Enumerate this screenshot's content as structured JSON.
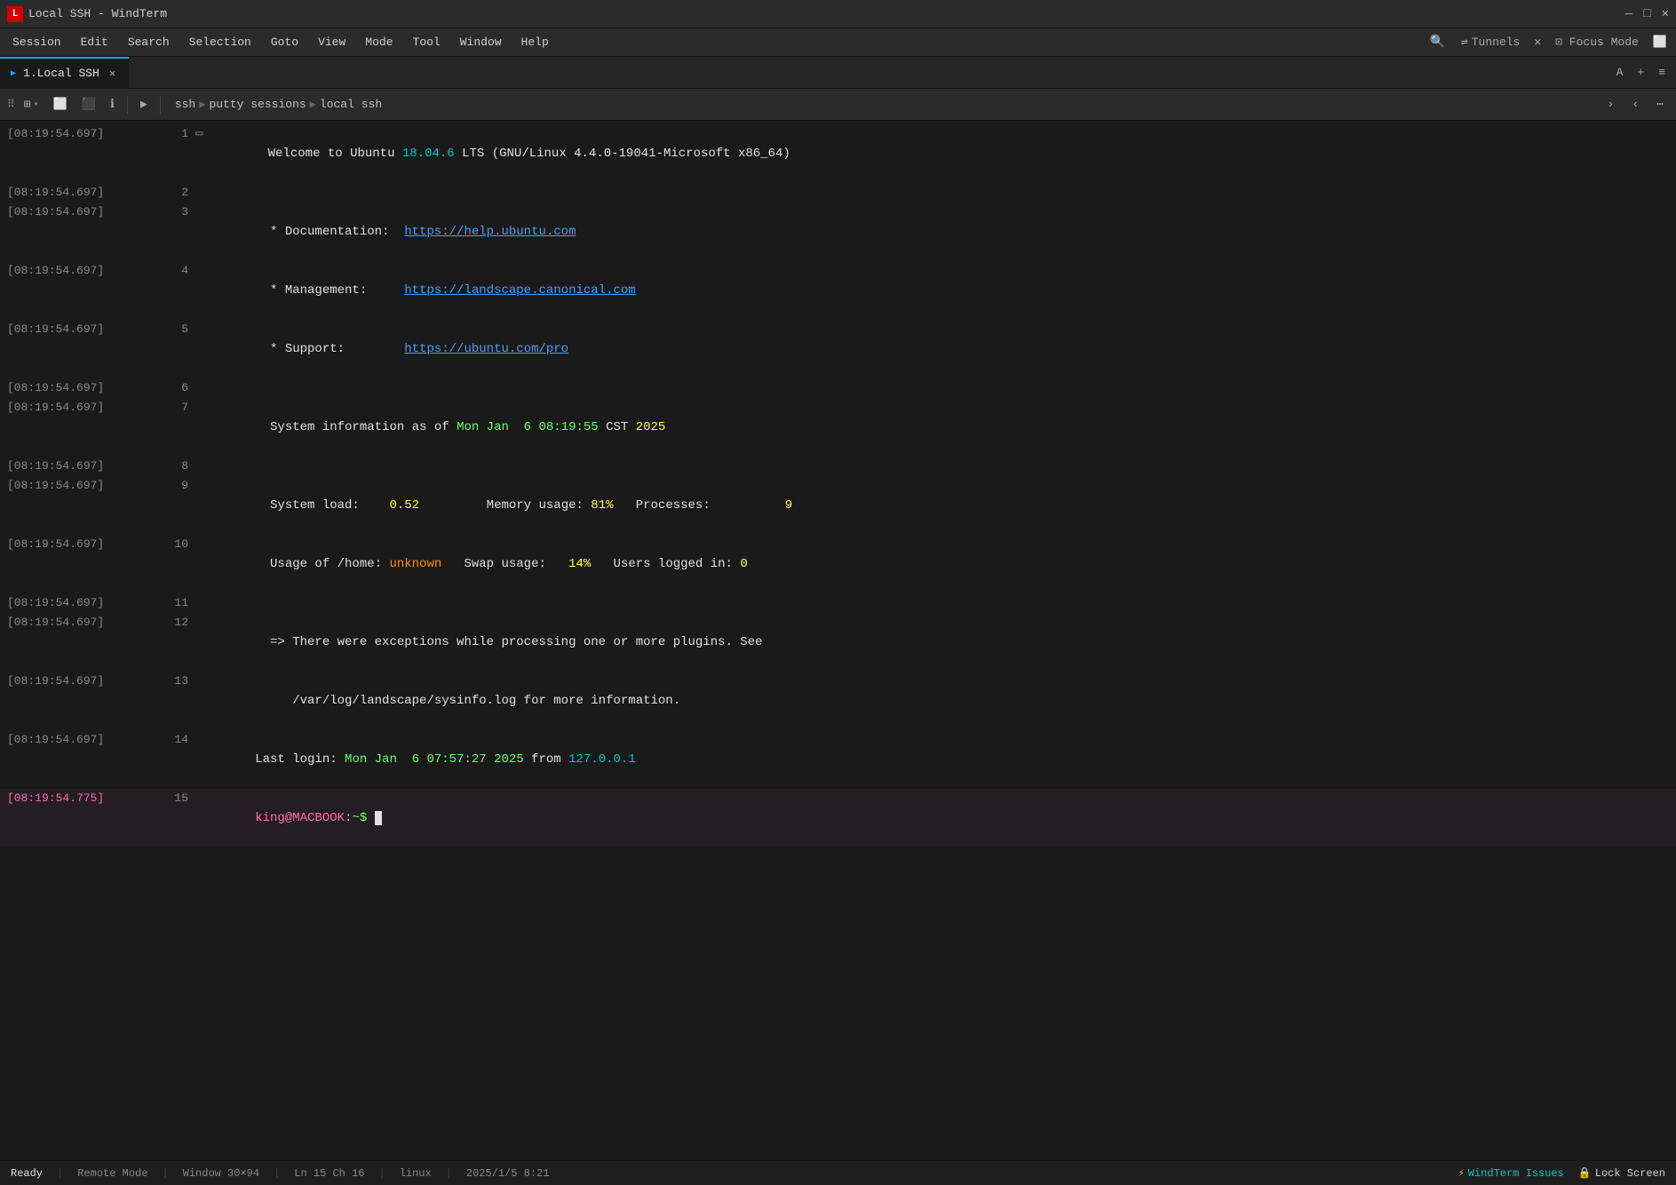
{
  "titlebar": {
    "app_icon_label": "L",
    "title": "Local SSH - WindTerm",
    "btn_minimize": "—",
    "btn_maximize": "□",
    "btn_close": "✕"
  },
  "menubar": {
    "items": [
      {
        "label": "Session"
      },
      {
        "label": "Edit"
      },
      {
        "label": "Search"
      },
      {
        "label": "Selection"
      },
      {
        "label": "Goto"
      },
      {
        "label": "View"
      },
      {
        "label": "Mode"
      },
      {
        "label": "Tool"
      },
      {
        "label": "Window"
      },
      {
        "label": "Help"
      }
    ],
    "search_icon": "🔍",
    "tunnels_label": "Tunnels",
    "close_label": "✕",
    "focus_mode_label": "⊡ Focus Mode",
    "layout_label": "⬜"
  },
  "tabbar": {
    "tabs": [
      {
        "label": "1.Local SSH",
        "active": true
      }
    ],
    "add_btn": "+",
    "menu_btn": "≡",
    "font_btn": "A"
  },
  "toolbar": {
    "new_split_btn": "⊞",
    "split_h_btn": "⬜",
    "split_v_btn": "⬜",
    "info_btn": "ℹ",
    "run_btn": "▶",
    "path_ssh": "ssh",
    "path_putty": "putty sessions",
    "path_local": "local ssh",
    "expand_btn": "›",
    "collapse_btn": "‹",
    "more_btn": "⋯"
  },
  "terminal": {
    "lines": [
      {
        "timestamp": "[08:19:54.697]",
        "linenum": "1",
        "content_parts": [
          {
            "text": "Welcome to Ubuntu ",
            "class": "c-white"
          },
          {
            "text": "18.04.6",
            "class": "c-cyan"
          },
          {
            "text": " LTS (GNU/Linux 4.4.0-19041-Microsoft x86_64)",
            "class": "c-white"
          }
        ]
      },
      {
        "timestamp": "[08:19:54.697]",
        "linenum": "2",
        "content_parts": []
      },
      {
        "timestamp": "[08:19:54.697]",
        "linenum": "3",
        "content_parts": [
          {
            "text": "  * Documentation:  ",
            "class": "c-white"
          },
          {
            "text": "https://help.ubuntu.com",
            "class": "c-blue-link"
          }
        ]
      },
      {
        "timestamp": "[08:19:54.697]",
        "linenum": "4",
        "content_parts": [
          {
            "text": "  * Management:     ",
            "class": "c-white"
          },
          {
            "text": "https://landscape.canonical.com",
            "class": "c-blue-link"
          }
        ]
      },
      {
        "timestamp": "[08:19:54.697]",
        "linenum": "5",
        "content_parts": [
          {
            "text": "  * Support:        ",
            "class": "c-white"
          },
          {
            "text": "https://ubuntu.com/pro",
            "class": "c-blue-link"
          }
        ]
      },
      {
        "timestamp": "[08:19:54.697]",
        "linenum": "6",
        "content_parts": []
      },
      {
        "timestamp": "[08:19:54.697]",
        "linenum": "7",
        "content_parts": [
          {
            "text": "  System information as of ",
            "class": "c-white"
          },
          {
            "text": "Mon Jan  6 ",
            "class": "c-green"
          },
          {
            "text": "08:19:55",
            "class": "c-green"
          },
          {
            "text": " CST ",
            "class": "c-white"
          },
          {
            "text": "2025",
            "class": "c-yellow"
          }
        ]
      },
      {
        "timestamp": "[08:19:54.697]",
        "linenum": "8",
        "content_parts": []
      },
      {
        "timestamp": "[08:19:54.697]",
        "linenum": "9",
        "content_parts": [
          {
            "text": "  System load:  ",
            "class": "c-white"
          },
          {
            "text": "  0.52",
            "class": "c-yellow"
          },
          {
            "text": "         Memory usage:  ",
            "class": "c-white"
          },
          {
            "text": "81%",
            "class": "c-yellow"
          },
          {
            "text": "   Processes:         ",
            "class": "c-white"
          },
          {
            "text": "9",
            "class": "c-yellow"
          }
        ]
      },
      {
        "timestamp": "[08:19:54.697]",
        "linenum": "10",
        "content_parts": [
          {
            "text": "  Usage of /home: ",
            "class": "c-white"
          },
          {
            "text": "unknown",
            "class": "c-orange"
          },
          {
            "text": "   Swap usage:   ",
            "class": "c-white"
          },
          {
            "text": "14%",
            "class": "c-yellow"
          },
          {
            "text": "   Users logged in: ",
            "class": "c-white"
          },
          {
            "text": "0",
            "class": "c-yellow"
          }
        ]
      },
      {
        "timestamp": "[08:19:54.697]",
        "linenum": "11",
        "content_parts": []
      },
      {
        "timestamp": "[08:19:54.697]",
        "linenum": "12",
        "content_parts": [
          {
            "text": "  => There were exceptions while processing one or more plugins. See",
            "class": "c-white"
          }
        ]
      },
      {
        "timestamp": "[08:19:54.697]",
        "linenum": "13",
        "content_parts": [
          {
            "text": "     /var/log/landscape/sysinfo.log for more information.",
            "class": "c-white"
          }
        ]
      },
      {
        "timestamp": "[08:19:54.697]",
        "linenum": "14",
        "content_parts": [
          {
            "text": "Last ",
            "class": "c-white"
          },
          {
            "text": "login",
            "class": "c-white"
          },
          {
            "text": ": ",
            "class": "c-white"
          },
          {
            "text": "Mon Jan  6 07:57:27 2025",
            "class": "c-green"
          },
          {
            "text": " from ",
            "class": "c-white"
          },
          {
            "text": "127.0.0.1",
            "class": "c-cyan"
          }
        ]
      },
      {
        "timestamp": "[08:19:54.775]",
        "linenum": "15",
        "active": true,
        "content_parts": [
          {
            "text": "king@MACBOOK",
            "class": "c-prompt-user"
          },
          {
            "text": ":~$",
            "class": "c-prompt-dollar"
          },
          {
            "text": " ",
            "class": "c-white"
          }
        ]
      }
    ]
  },
  "statusbar": {
    "ready_label": "Ready",
    "remote_mode_label": "Remote Mode",
    "window_size_label": "Window 30×94",
    "cursor_label": "Ln 15 Ch 16",
    "os_label": "linux",
    "datetime_label": "2025/1/5 8:21",
    "issues_label": "WindTerm Issues",
    "lock_screen_label": "Lock Screen"
  }
}
